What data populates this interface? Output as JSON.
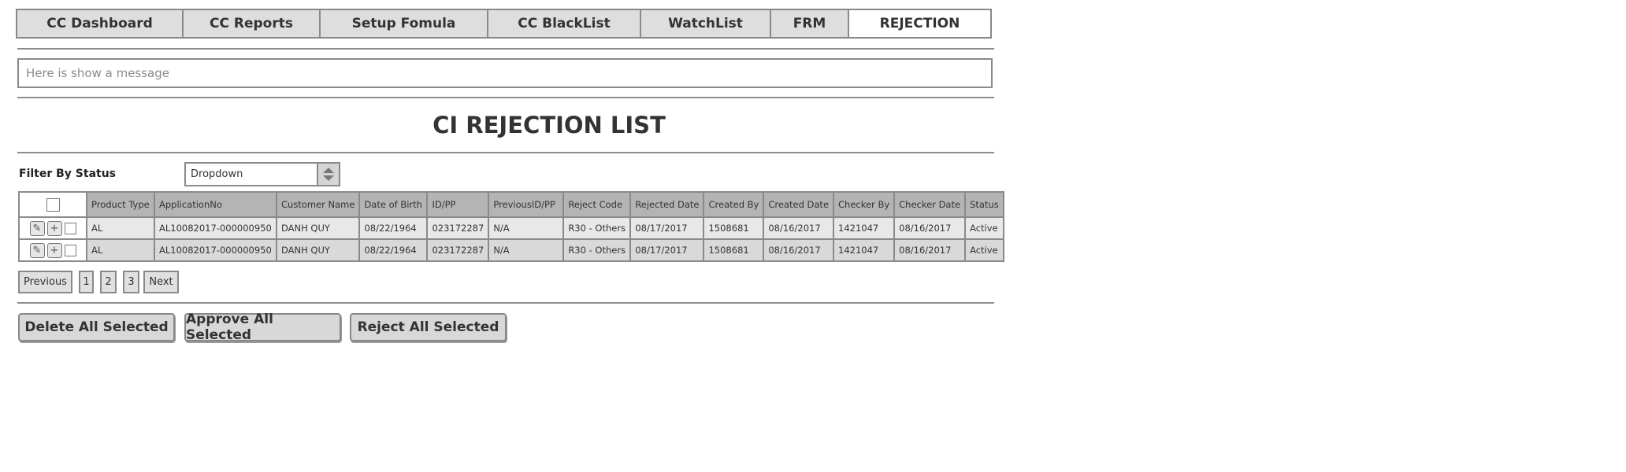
{
  "tabs": [
    {
      "label": "CC Dashboard",
      "active": false
    },
    {
      "label": "CC Reports",
      "active": false
    },
    {
      "label": "Setup Fomula",
      "active": false
    },
    {
      "label": "CC BlackList",
      "active": false
    },
    {
      "label": "WatchList",
      "active": false
    },
    {
      "label": "FRM",
      "active": false
    },
    {
      "label": "REJECTION",
      "active": true
    }
  ],
  "message": {
    "placeholder": "Here is show a message"
  },
  "page": {
    "title": "CI REJECTION LIST"
  },
  "filter": {
    "label": "Filter By Status",
    "dropdown_value": "Dropdown"
  },
  "table": {
    "columns": [
      "Product Type",
      "ApplicationNo",
      "Customer Name",
      "Date of Birth",
      "ID/PP",
      "PreviousID/PP",
      "Reject Code",
      "Rejected Date",
      "Created By",
      "Created Date",
      "Checker By",
      "Checker Date",
      "Status"
    ],
    "rows": [
      [
        "AL",
        "AL10082017-000000950",
        "DANH QUY",
        "08/22/1964",
        "023172287",
        "N/A",
        "R30 - Others",
        "08/17/2017",
        "1508681",
        "08/16/2017",
        "1421047",
        "08/16/2017",
        "Active"
      ],
      [
        "AL",
        "AL10082017-000000950",
        "DANH QUY",
        "08/22/1964",
        "023172287",
        "N/A",
        "R30 - Others",
        "08/17/2017",
        "1508681",
        "08/16/2017",
        "1421047",
        "08/16/2017",
        "Active"
      ]
    ],
    "row_icons": [
      "pencil-icon",
      "plus-icon",
      "checkbox"
    ]
  },
  "pagination": {
    "previous": "Previous",
    "pages": [
      "1",
      "2",
      "3"
    ],
    "next": "Next"
  },
  "actions": {
    "delete_all": "Delete All Selected",
    "approve_all": "Approve All Selected",
    "reject_all": "Reject All Selected"
  }
}
